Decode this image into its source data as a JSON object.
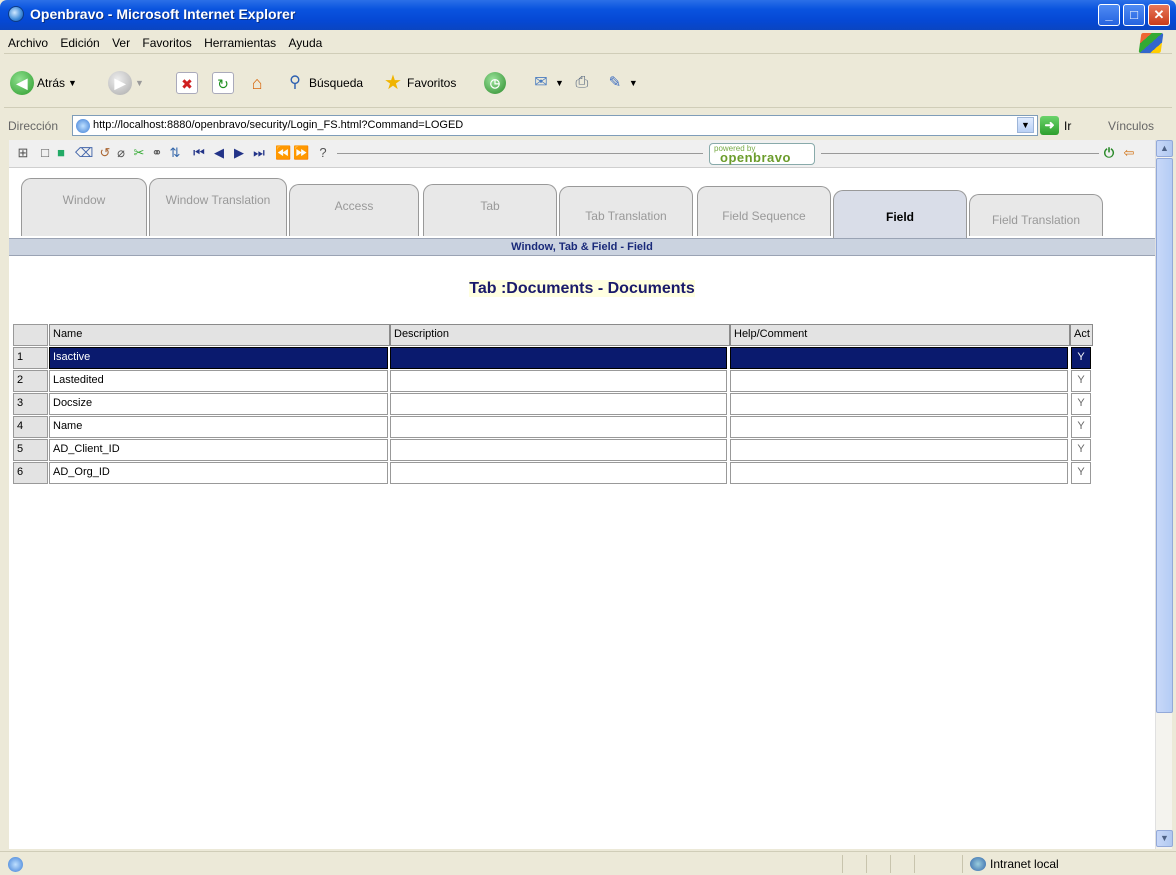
{
  "window": {
    "title": "Openbravo - Microsoft Internet Explorer"
  },
  "menu": [
    "Archivo",
    "Edición",
    "Ver",
    "Favoritos",
    "Herramientas",
    "Ayuda"
  ],
  "toolbar": {
    "back_label": "Atrás",
    "search_label": "Búsqueda",
    "favorites_label": "Favoritos"
  },
  "address": {
    "label": "Dirección",
    "url": "http://localhost:8880/openbravo/security/Login_FS.html?Command=LOGED",
    "go_label": "Ir",
    "links_label": "Vínculos"
  },
  "app": {
    "brand_small": "powered by",
    "brand_name": "openbravo",
    "tabs": [
      "Window",
      "Window Translation",
      "Access",
      "Tab",
      "Tab Translation",
      "Field Sequence",
      "Field",
      "Field Translation"
    ],
    "active_tab": "Field",
    "subheader": "Window, Tab & Field - Field",
    "tab_title": "Tab :Documents - Documents",
    "grid": {
      "columns": [
        "",
        "Name",
        "Description",
        "Help/Comment",
        "Act"
      ],
      "rows": [
        {
          "n": "1",
          "name": "Isactive",
          "desc": "",
          "help": "",
          "act": "Y",
          "selected": true
        },
        {
          "n": "2",
          "name": "Lastedited",
          "desc": "",
          "help": "",
          "act": "Y"
        },
        {
          "n": "3",
          "name": "Docsize",
          "desc": "",
          "help": "",
          "act": "Y"
        },
        {
          "n": "4",
          "name": "Name",
          "desc": "",
          "help": "",
          "act": "Y"
        },
        {
          "n": "5",
          "name": "AD_Client_ID",
          "desc": "",
          "help": "",
          "act": "Y"
        },
        {
          "n": "6",
          "name": "AD_Org_ID",
          "desc": "",
          "help": "",
          "act": "Y"
        }
      ]
    }
  },
  "status": {
    "zone": "Intranet local"
  }
}
